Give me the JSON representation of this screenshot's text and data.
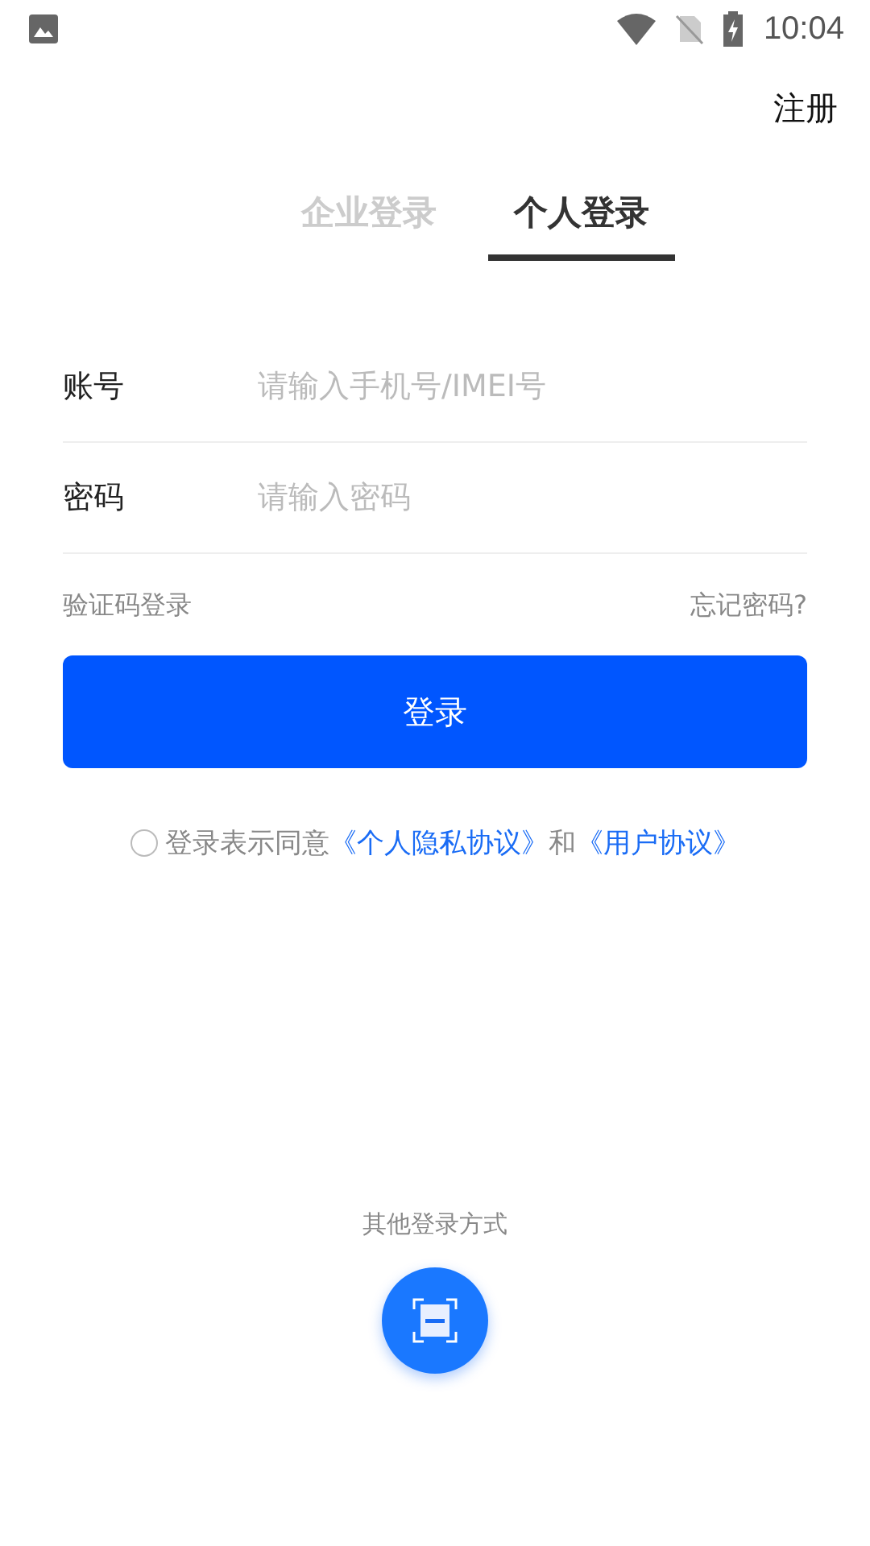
{
  "status_bar": {
    "time": "10:04"
  },
  "header": {
    "register": "注册"
  },
  "tabs": [
    {
      "label": "企业登录",
      "selected": false
    },
    {
      "label": "个人登录",
      "selected": true
    }
  ],
  "form": {
    "fields": [
      {
        "label": "账号",
        "placeholder": "请输入手机号/IMEI号"
      },
      {
        "label": "密码",
        "placeholder": "请输入密码"
      }
    ],
    "code_login": "验证码登录",
    "forgot": "忘记密码?",
    "submit": "登录"
  },
  "agreement": {
    "checked": false,
    "text": "登录表示同意",
    "link_1": "《个人隐私协议》",
    "joiner": "和",
    "link_2": "《用户协议》"
  },
  "other_login": {
    "title": "其他登录方式"
  }
}
